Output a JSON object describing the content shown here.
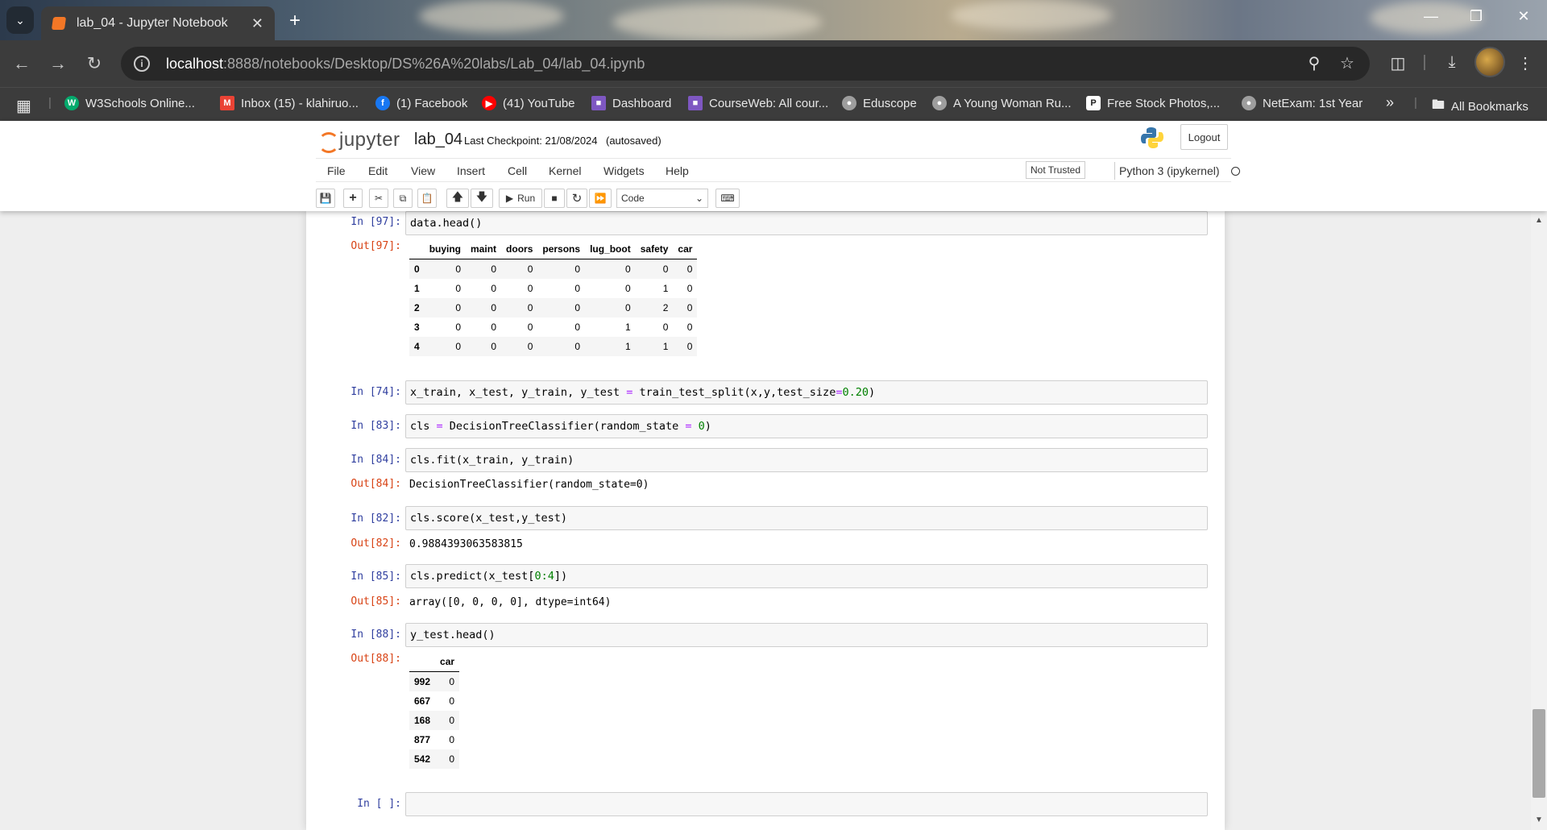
{
  "browser": {
    "tab_title": "lab_04 - Jupyter Notebook",
    "new_tab": "+",
    "url_host": "localhost",
    "url_path": ":8888/notebooks/Desktop/DS%26A%20labs/Lab_04/lab_04.ipynb",
    "bookmarks": [
      {
        "label": "W3Schools Online...",
        "icon": "w3schools-icon",
        "color": "#04aa6d"
      },
      {
        "label": "Inbox (15) - klahiruo...",
        "icon": "gmail-icon",
        "color": "#ea4335"
      },
      {
        "label": "(1) Facebook",
        "icon": "facebook-icon",
        "color": "#1877f2"
      },
      {
        "label": "(41) YouTube",
        "icon": "youtube-icon",
        "color": "#ff0000"
      },
      {
        "label": "Dashboard",
        "icon": "moodle-icon",
        "color": "#7e57c2"
      },
      {
        "label": "CourseWeb: All cour...",
        "icon": "moodle-icon",
        "color": "#7e57c2"
      },
      {
        "label": "Eduscope",
        "icon": "globe-icon",
        "color": "#9e9e9e"
      },
      {
        "label": "A Young Woman Ru...",
        "icon": "globe-icon",
        "color": "#9e9e9e"
      },
      {
        "label": "Free Stock Photos,...",
        "icon": "pexels-icon",
        "color": "#ffffff"
      },
      {
        "label": "NetExam: 1st Year",
        "icon": "globe-icon",
        "color": "#9e9e9e"
      }
    ],
    "more": "»",
    "all_bookmarks": "All Bookmarks"
  },
  "jupyter": {
    "logo_text": "jupyter",
    "notebook_name": "lab_04",
    "checkpoint": "Last Checkpoint: 21/08/2024",
    "autosaved": "(autosaved)",
    "logout": "Logout",
    "menu": [
      "File",
      "Edit",
      "View",
      "Insert",
      "Cell",
      "Kernel",
      "Widgets",
      "Help"
    ],
    "trust": "Not Trusted",
    "kernel_name": "Python 3 (ipykernel)",
    "run_label": "Run",
    "cell_type": "Code"
  },
  "cells": {
    "c97": {
      "in": "In [97]:",
      "out": "Out[97]:",
      "code": "data.head()"
    },
    "c74": {
      "in": "In [74]:",
      "code_a": "x_train, x_test, y_train, y_test ",
      "op": "=",
      "code_b": " train_test_split(x,y,test_size",
      "op2": "=",
      "num": "0.20",
      "code_c": ")"
    },
    "c83": {
      "in": "In [83]:",
      "code_a": "cls ",
      "op": "=",
      "code_b": " DecisionTreeClassifier(random_state ",
      "op2": "=",
      "num": " 0",
      "code_c": ")"
    },
    "c84": {
      "in": "In [84]:",
      "out": "Out[84]:",
      "code": "cls.fit(x_train, y_train)",
      "output": "DecisionTreeClassifier(random_state=0)"
    },
    "c82": {
      "in": "In [82]:",
      "out": "Out[82]:",
      "code": "cls.score(x_test,y_test)",
      "output": "0.9884393063583815"
    },
    "c85": {
      "in": "In [85]:",
      "out": "Out[85]:",
      "code_a": "cls.predict(x_test[",
      "num": "0",
      "op": ":",
      "num2": "4",
      "code_c": "])",
      "output": "array([0, 0, 0, 0], dtype=int64)"
    },
    "c88": {
      "in": "In [88]:",
      "out": "Out[88]:",
      "code": "y_test.head()"
    },
    "empty": {
      "in": "In [ ]:"
    }
  },
  "df_head": {
    "columns": [
      "",
      "buying",
      "maint",
      "doors",
      "persons",
      "lug_boot",
      "safety",
      "car"
    ],
    "rows": [
      [
        "0",
        "0",
        "0",
        "0",
        "0",
        "0",
        "0",
        "0"
      ],
      [
        "1",
        "0",
        "0",
        "0",
        "0",
        "0",
        "1",
        "0"
      ],
      [
        "2",
        "0",
        "0",
        "0",
        "0",
        "0",
        "2",
        "0"
      ],
      [
        "3",
        "0",
        "0",
        "0",
        "0",
        "1",
        "0",
        "0"
      ],
      [
        "4",
        "0",
        "0",
        "0",
        "0",
        "1",
        "1",
        "0"
      ]
    ]
  },
  "y_test_head": {
    "columns": [
      "",
      "car"
    ],
    "rows": [
      [
        "992",
        "0"
      ],
      [
        "667",
        "0"
      ],
      [
        "168",
        "0"
      ],
      [
        "877",
        "0"
      ],
      [
        "542",
        "0"
      ]
    ]
  }
}
